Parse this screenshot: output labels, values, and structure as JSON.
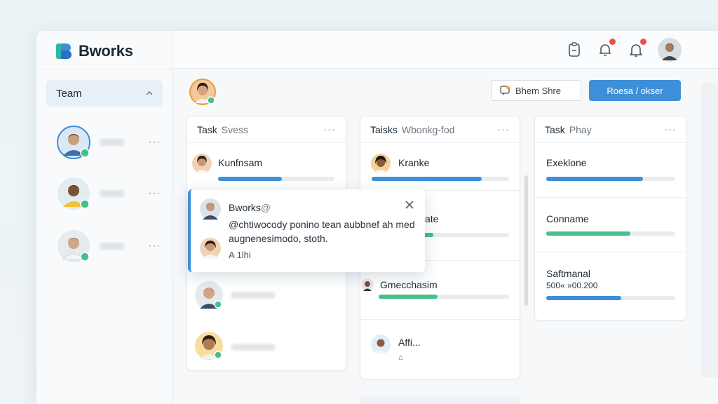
{
  "app": {
    "name": "Bworks"
  },
  "sidebar": {
    "section_label": "Team",
    "members": [
      {
        "more": "···"
      },
      {
        "more": "···"
      },
      {
        "more": "···"
      }
    ]
  },
  "toolbar": {
    "share_label": "Bhem Shre",
    "primary_label": "Roesa / okser"
  },
  "columns": [
    {
      "title": "Task",
      "subtitle": "Svess",
      "more": "···",
      "cards": [
        {
          "title": "Kunfnsam",
          "progress": 0.55,
          "color": "#3f8fd8"
        }
      ]
    },
    {
      "title": "Taisks",
      "subtitle": "Wbonkg-fod",
      "more": "···",
      "cards": [
        {
          "title": "Kranke",
          "progress": 0.8,
          "color": "#3f8fd8"
        },
        {
          "title": "ate",
          "progress": 0.45,
          "color": "#45c08a"
        },
        {
          "title": "Gmecchasim",
          "progress": 0.45,
          "color": "#45c08a"
        },
        {
          "title": "Affi...",
          "sub": "⌂"
        }
      ]
    },
    {
      "title": "Task",
      "subtitle": "Phay",
      "more": "···",
      "cards": [
        {
          "title": "Exeklone",
          "progress": 0.75,
          "color": "#3f8fd8"
        },
        {
          "title": "Conname",
          "progress": 0.65,
          "color": "#45c08a"
        },
        {
          "title": "Saftmanal",
          "sub": "500« »00.200",
          "progress": 0.58,
          "color": "#3f8fd8"
        }
      ]
    }
  ],
  "popup": {
    "title": "Bworks",
    "title_suffix": "@",
    "message": "@chtiwocody ponino tean aubbnef ah med augnenesimodo, stoth.",
    "meta": "A 1lhi",
    "close": "×"
  }
}
